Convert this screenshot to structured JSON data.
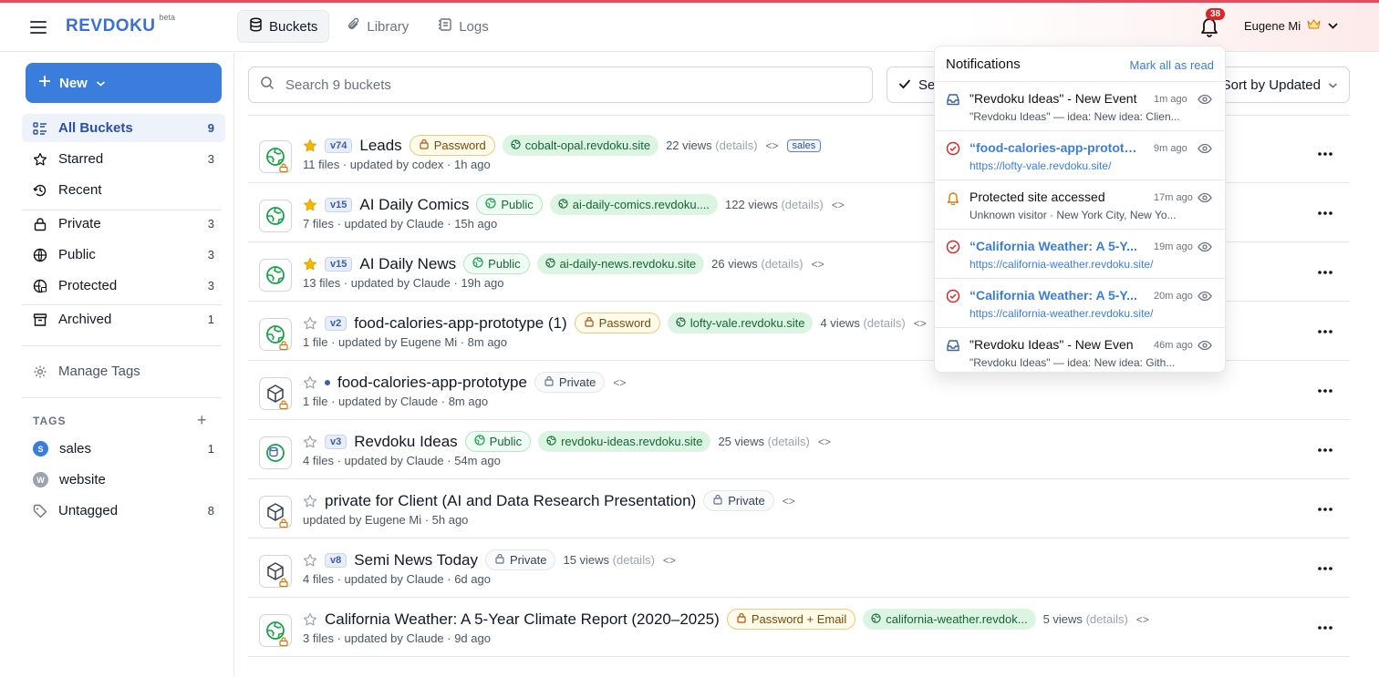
{
  "app": {
    "name": "REVDOKU",
    "beta": "beta"
  },
  "nav_tabs": [
    {
      "label": "Buckets"
    },
    {
      "label": "Library"
    },
    {
      "label": "Logs"
    }
  ],
  "notifications_count": "38",
  "user_name": "Eugene Mi",
  "sidebar": {
    "new_label": "New",
    "items": [
      {
        "label": "All Buckets",
        "count": "9"
      },
      {
        "label": "Starred",
        "count": "3"
      },
      {
        "label": "Recent",
        "count": ""
      },
      {
        "label": "Private",
        "count": "3"
      },
      {
        "label": "Public",
        "count": "3"
      },
      {
        "label": "Protected",
        "count": "3"
      },
      {
        "label": "Archived",
        "count": "1"
      }
    ],
    "manage_tags": "Manage Tags",
    "tags_heading": "TAGS",
    "tags": [
      {
        "label": "sales",
        "count": "1",
        "initial": "S",
        "color": "#3b7ddd"
      },
      {
        "label": "website",
        "count": "",
        "initial": "W",
        "color": "#9ca3af"
      },
      {
        "label": "Untagged",
        "count": "8"
      }
    ]
  },
  "toolbar": {
    "search_placeholder": "Search 9 buckets",
    "select_label": "Se",
    "sort_label": "Sort by Updated"
  },
  "buckets": [
    {
      "version": "v74",
      "title": "Leads",
      "access": "Password",
      "domain": "cobalt-opal.revdoku.site",
      "views": "22 views",
      "details": "(details)",
      "tag": "sales",
      "meta": "11 files · updated by codex · 1h ago",
      "starred": true
    },
    {
      "version": "v15",
      "title": "AI Daily Comics",
      "access": "Public",
      "domain": "ai-daily-comics.revdoku....",
      "views": "122 views",
      "details": "(details)",
      "meta": "7 files · updated by Claude · 15h ago",
      "starred": true
    },
    {
      "version": "v15",
      "title": "AI Daily News",
      "access": "Public",
      "domain": "ai-daily-news.revdoku.site",
      "views": "26 views",
      "details": "(details)",
      "meta": "13 files · updated by Claude · 19h ago",
      "starred": true
    },
    {
      "version": "v2",
      "title": "food-calories-app-prototype (1)",
      "access": "Password",
      "domain": "lofty-vale.revdoku.site",
      "views": "4 views",
      "details": "(details)",
      "meta": "1 file · updated by Eugene Mi · 8m ago",
      "starred": false
    },
    {
      "version": "",
      "title": "food-calories-app-prototype",
      "access": "Private",
      "domain": "",
      "views": "",
      "details": "",
      "meta": "1 file · updated by Claude · 8m ago",
      "starred": false
    },
    {
      "version": "v3",
      "title": "Revdoku Ideas",
      "access": "Public",
      "domain": "revdoku-ideas.revdoku.site",
      "views": "25 views",
      "details": "(details)",
      "meta": "4 files · updated by Claude · 54m ago",
      "starred": false
    },
    {
      "version": "",
      "title": "private for Client (AI and Data Research Presentation)",
      "access": "Private",
      "domain": "",
      "views": "",
      "details": "",
      "meta": "updated by Eugene Mi · 5h ago",
      "starred": false
    },
    {
      "version": "v8",
      "title": "Semi News Today",
      "access": "Private",
      "domain": "",
      "views": "15 views",
      "details": "(details)",
      "meta": "4 files · updated by Claude · 6d ago",
      "starred": false
    },
    {
      "version": "",
      "title": "California Weather: A 5-Year Climate Report (2020–2025)",
      "access": "Password + Email",
      "domain": "california-weather.revdok...",
      "views": "5 views",
      "details": "(details)",
      "meta": "3 files · updated by Claude · 9d ago",
      "starred": false
    }
  ],
  "notif_panel": {
    "title": "Notifications",
    "mark_all": "Mark all as read",
    "items": [
      {
        "title": "\"Revdoku Ideas\" - New Event",
        "time": "1m ago",
        "sub": "\"Revdoku Ideas\" — idea: New idea: Clien...",
        "kind": "inbox"
      },
      {
        "title": "“food-calories-app-prototy...",
        "time": "9m ago",
        "sub": "https://lofty-vale.revdoku.site/",
        "kind": "check"
      },
      {
        "title": "Protected site accessed",
        "time": "17m ago",
        "sub": "Unknown visitor · New York City, New Yo...",
        "kind": "bell"
      },
      {
        "title": "“California Weather: A 5-Y...",
        "time": "19m ago",
        "sub": "https://california-weather.revdoku.site/",
        "kind": "check"
      },
      {
        "title": "“California Weather: A 5-Y...",
        "time": "20m ago",
        "sub": "https://california-weather.revdoku.site/",
        "kind": "check"
      },
      {
        "title": "\"Revdoku Ideas\" - New Even",
        "time": "46m ago",
        "sub": "\"Revdoku Ideas\" — idea: New idea: Gith...",
        "kind": "inbox"
      }
    ]
  },
  "colors": {
    "accent": "#3b7ddd",
    "top_bar": "#e84a5f",
    "badge_red": "#dc2626",
    "domain_green": "#dcf5e3"
  }
}
